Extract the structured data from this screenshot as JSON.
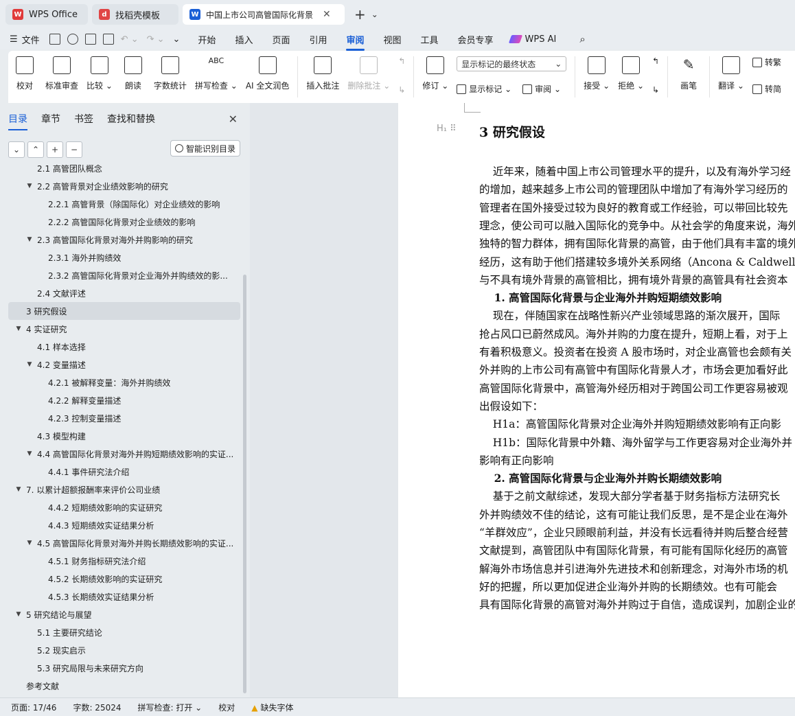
{
  "tabs": [
    {
      "label": "WPS Office",
      "logo_color": "#e03a3a",
      "logo_char": "W"
    },
    {
      "label": "找稻壳模板",
      "logo_color": "#e04545",
      "logo_char": "d"
    },
    {
      "label": "中国上市公司高管国际化背景",
      "logo_color": "#1a5fd6",
      "logo_char": "W"
    }
  ],
  "menubar": {
    "file": "文件",
    "tabs": [
      "开始",
      "插入",
      "页面",
      "引用",
      "审阅",
      "视图",
      "工具",
      "会员专享"
    ],
    "active_tab": "审阅",
    "wps_ai": "WPS AI"
  },
  "ribbon": {
    "proofread": "校对",
    "standard_review": "标准审查",
    "compare": "比较",
    "read_aloud": "朗读",
    "word_count": "字数统计",
    "spell_check": "拼写检查",
    "ai_polish": "AI 全文润色",
    "insert_comment": "插入批注",
    "delete_comment": "删除批注",
    "revise": "修订",
    "markup_select": "显示标记的最终状态",
    "show_markup": "显示标记",
    "review": "审阅",
    "accept": "接受",
    "reject": "拒绝",
    "pen": "画笔",
    "translate": "翻译",
    "to_traditional": "转繁",
    "to_simplified": "转简"
  },
  "left_panel": {
    "tabs": [
      "目录",
      "章节",
      "书签",
      "查找和替换"
    ],
    "active_tab": "目录",
    "smart_toc": "智能识别目录",
    "toc": [
      {
        "label": "2.1 高管团队概念",
        "level": 2,
        "arrow": ""
      },
      {
        "label": "2.2 高管背景对企业绩效影响的研究",
        "level": 2,
        "arrow": "▼"
      },
      {
        "label": "2.2.1 高管背景（除国际化）对企业绩效的影响",
        "level": 3,
        "arrow": ""
      },
      {
        "label": "2.2.2 高管国际化背景对企业绩效的影响",
        "level": 3,
        "arrow": ""
      },
      {
        "label": "2.3 高管国际化背景对海外并购影响的研究",
        "level": 2,
        "arrow": "▼"
      },
      {
        "label": "2.3.1 海外并购绩效",
        "level": 3,
        "arrow": ""
      },
      {
        "label": "2.3.2 高管国际化背景对企业海外并购绩效的影...",
        "level": 3,
        "arrow": ""
      },
      {
        "label": "2.4 文献评述",
        "level": 2,
        "arrow": ""
      },
      {
        "label": "3 研究假设",
        "level": 1,
        "arrow": "",
        "selected": true
      },
      {
        "label": "4 实证研究",
        "level": 1,
        "arrow": "▼"
      },
      {
        "label": "4.1 样本选择",
        "level": 2,
        "arrow": ""
      },
      {
        "label": "4.2 变量描述",
        "level": 2,
        "arrow": "▼"
      },
      {
        "label": "4.2.1 被解释变量：海外并购绩效",
        "level": 3,
        "arrow": ""
      },
      {
        "label": "4.2.2 解释变量描述",
        "level": 3,
        "arrow": ""
      },
      {
        "label": "4.2.3 控制变量描述",
        "level": 3,
        "arrow": ""
      },
      {
        "label": "4.3 模型构建",
        "level": 2,
        "arrow": ""
      },
      {
        "label": "4.4 高管国际化背景对海外并购短期绩效影响的实证...",
        "level": 2,
        "arrow": "▼"
      },
      {
        "label": "4.4.1 事件研究法介绍",
        "level": 3,
        "arrow": ""
      },
      {
        "label": "7. 以累计超额报酬率来评价公司业绩",
        "level": 1,
        "arrow": "▼"
      },
      {
        "label": "4.4.2 短期绩效影响的实证研究",
        "level": 3,
        "arrow": ""
      },
      {
        "label": "4.4.3 短期绩效实证结果分析",
        "level": 3,
        "arrow": ""
      },
      {
        "label": "4.5 高管国际化背景对海外并购长期绩效影响的实证...",
        "level": 2,
        "arrow": "▼"
      },
      {
        "label": "4.5.1 财务指标研究法介绍",
        "level": 3,
        "arrow": ""
      },
      {
        "label": "4.5.2 长期绩效影响的实证研究",
        "level": 3,
        "arrow": ""
      },
      {
        "label": "4.5.3 长期绩效实证结果分析",
        "level": 3,
        "arrow": ""
      },
      {
        "label": "5 研究结论与展望",
        "level": 1,
        "arrow": "▼"
      },
      {
        "label": "5.1 主要研究结论",
        "level": 2,
        "arrow": ""
      },
      {
        "label": "5.2 现实启示",
        "level": 2,
        "arrow": ""
      },
      {
        "label": "5.3 研究局限与未来研究方向",
        "level": 2,
        "arrow": ""
      },
      {
        "label": "参考文献",
        "level": 1,
        "arrow": ""
      }
    ]
  },
  "document": {
    "heading": "3  研究假设",
    "heading_mark": "H₁ ⠿",
    "lines": [
      {
        "text": "    近年来，随着中国上市公司管理水平的提升，以及有海外学习经",
        "bold": false
      },
      {
        "text": "的增加，越来越多上市公司的管理团队中增加了有海外学习经历的",
        "bold": false
      },
      {
        "text": "管理者在国外接受过较为良好的教育或工作经验，可以带回比较先",
        "bold": false
      },
      {
        "text": "理念，使公司可以融入国际化的竞争中。从社会学的角度来说，海外",
        "bold": false
      },
      {
        "text": "独特的智力群体，拥有国际化背景的高管，由于他们具有丰富的境外",
        "bold": false
      },
      {
        "text": "经历，这有助于他们搭建较多境外关系网络（Ancona & Caldwell，",
        "bold": false
      },
      {
        "text": "与不具有境外背景的高管相比，拥有境外背景的高管具有社会资本",
        "bold": false
      },
      {
        "text": "    1. 高管国际化背景与企业海外并购短期绩效影响",
        "bold": true
      },
      {
        "text": "    现在，伴随国家在战略性新兴产业领域思路的渐次展开，国际",
        "bold": false
      },
      {
        "text": "抢占风口已蔚然成风。海外并购的力度在提升，短期上看，对于上",
        "bold": false
      },
      {
        "text": "有着积极意义。投资者在投资 A 股市场时，对企业高管也会颇有关",
        "bold": false
      },
      {
        "text": "外并购的上市公司有高管中有国际化背景人才，市场会更加看好此",
        "bold": false
      },
      {
        "text": "高管国际化背景中，高管海外经历相对于跨国公司工作更容易被观",
        "bold": false
      },
      {
        "text": "出假设如下：",
        "bold": false
      },
      {
        "text": "    H1a：高管国际化背景对企业海外并购短期绩效影响有正向影",
        "bold": false
      },
      {
        "text": "    H1b：国际化背景中外籍、海外留学与工作更容易对企业海外并",
        "bold": false
      },
      {
        "text": "影响有正向影响",
        "bold": false
      },
      {
        "text": "    2. 高管国际化背景与企业海外并购长期绩效影响",
        "bold": true
      },
      {
        "text": "    基于之前文献综述，发现大部分学者基于财务指标方法研究长",
        "bold": false
      },
      {
        "text": "外并购绩效不佳的结论，这有可能让我们反思，是不是企业在海外",
        "bold": false
      },
      {
        "text": "“羊群效应”，企业只顾眼前利益，并没有长远看待并购后整合经营",
        "bold": false
      },
      {
        "text": "文献提到，高管团队中有国际化背景，有可能有国际化经历的高管",
        "bold": false
      },
      {
        "text": "解海外市场信息并引进海外先进技术和创新理念，对海外市场的机",
        "bold": false
      },
      {
        "text": "好的把握，所以更加促进企业海外并购的长期绩效。也有可能会",
        "bold": false
      },
      {
        "text": "具有国际化背景的高管对海外并购过于自信，造成误判，加剧企业的",
        "bold": false
      }
    ]
  },
  "statusbar": {
    "page": "页面: 17/46",
    "words": "字数: 25024",
    "spell": "拼写检查: 打开 ⌄",
    "proof": "校对",
    "missing_font": "缺失字体"
  }
}
